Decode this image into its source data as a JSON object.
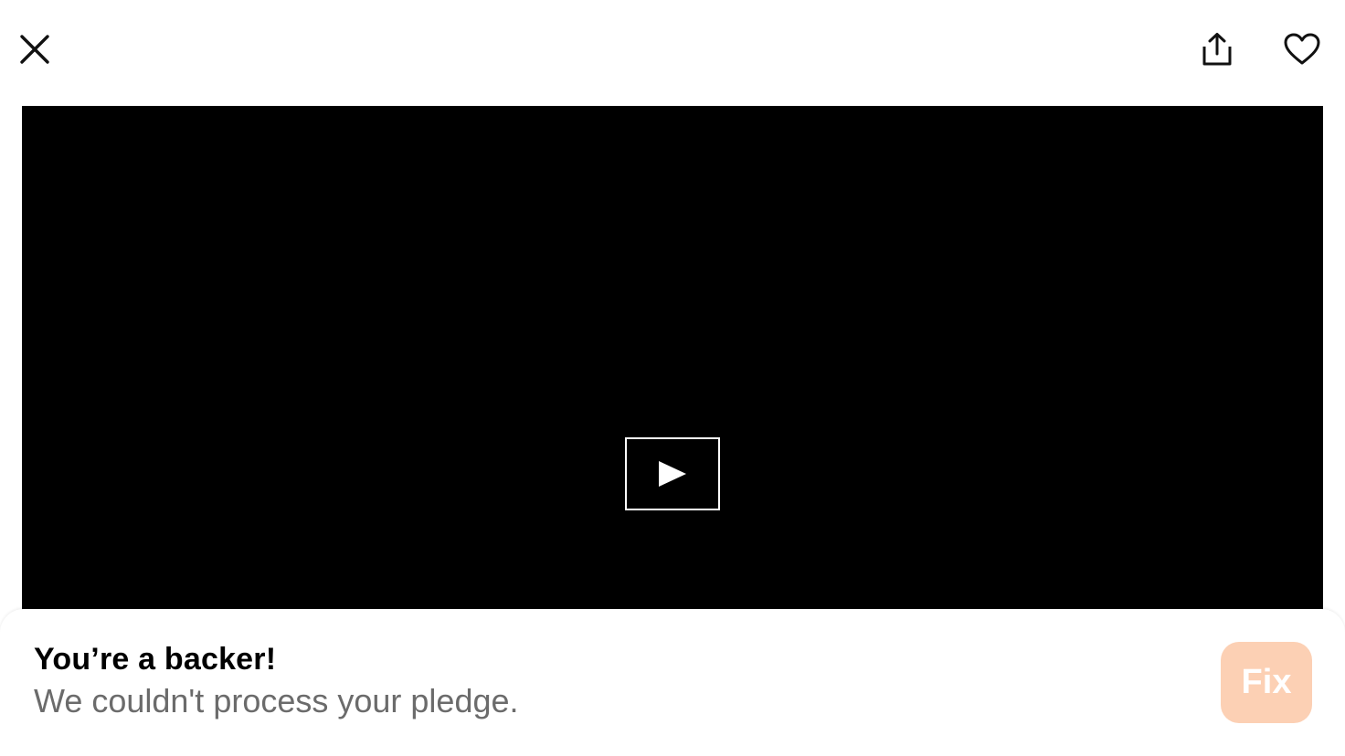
{
  "nav": {
    "close_icon": "close-icon",
    "share_icon": "share-icon",
    "favorite_icon": "heart-icon"
  },
  "video": {
    "play_icon": "play-icon",
    "background": "#000000"
  },
  "banner": {
    "title": "You’re a backer!",
    "subtitle": "We couldn't process your pledge.",
    "fix_label": "Fix",
    "fix_color": "#fcd0b4"
  }
}
